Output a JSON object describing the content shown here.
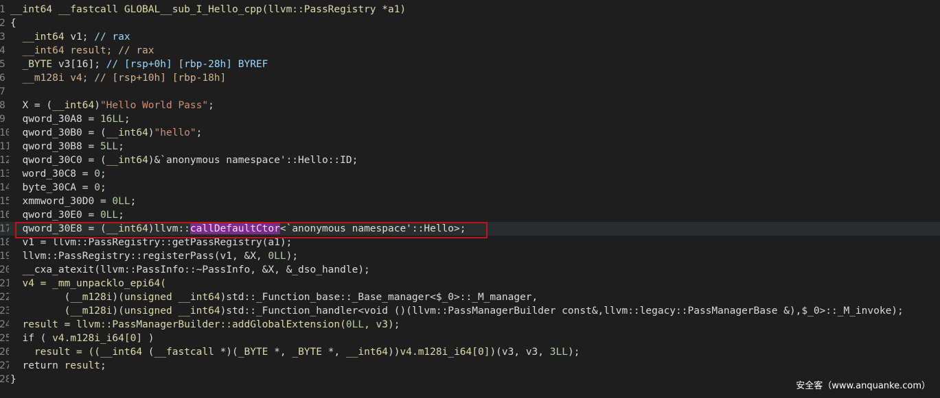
{
  "lines": [
    {
      "n": "1",
      "segments": [
        {
          "t": "__int64 __fastcall GLOBAL__sub_I_Hello_cpp(llvm::PassRegistry *a1)",
          "c": "k"
        }
      ]
    },
    {
      "n": "2",
      "segments": [
        {
          "t": "{",
          "c": ""
        }
      ]
    },
    {
      "n": "3",
      "segments": [
        {
          "t": "  __int64 ",
          "c": "k"
        },
        {
          "t": "v1; ",
          "c": ""
        },
        {
          "t": "// rax",
          "c": "c"
        }
      ]
    },
    {
      "n": "4",
      "segments": [
        {
          "t": "  __int64 result; // rax",
          "c": "kw"
        }
      ]
    },
    {
      "n": "5",
      "segments": [
        {
          "t": "  _BYTE ",
          "c": "k"
        },
        {
          "t": "v3[16]; ",
          "c": ""
        },
        {
          "t": "// [rsp+0h] [rbp-28h] BYREF",
          "c": "c"
        }
      ]
    },
    {
      "n": "6",
      "segments": [
        {
          "t": "  __m128i v4; // [rsp+10h] [rbp-18h]",
          "c": "kw"
        }
      ]
    },
    {
      "n": "7",
      "segments": [
        {
          "t": "",
          "c": ""
        }
      ]
    },
    {
      "n": "8",
      "segments": [
        {
          "t": "  X = (",
          "c": ""
        },
        {
          "t": "__int64",
          "c": "k"
        },
        {
          "t": ")",
          "c": ""
        },
        {
          "t": "\"Hello World Pass\"",
          "c": "s"
        },
        {
          "t": ";",
          "c": ""
        }
      ]
    },
    {
      "n": "9",
      "segments": [
        {
          "t": "  qword_30A8 = ",
          "c": ""
        },
        {
          "t": "16LL",
          "c": "n"
        },
        {
          "t": ";",
          "c": ""
        }
      ]
    },
    {
      "n": "10",
      "segments": [
        {
          "t": "  qword_30B0 = (",
          "c": ""
        },
        {
          "t": "__int64",
          "c": "k"
        },
        {
          "t": ")",
          "c": ""
        },
        {
          "t": "\"hello\"",
          "c": "s"
        },
        {
          "t": ";",
          "c": ""
        }
      ]
    },
    {
      "n": "11",
      "segments": [
        {
          "t": "  qword_30B8 = ",
          "c": ""
        },
        {
          "t": "5LL",
          "c": "n"
        },
        {
          "t": ";",
          "c": ""
        }
      ]
    },
    {
      "n": "12",
      "segments": [
        {
          "t": "  qword_30C0 = (",
          "c": ""
        },
        {
          "t": "__int64",
          "c": "k"
        },
        {
          "t": ")&`anonymous namespace'::Hello::ID;",
          "c": ""
        }
      ]
    },
    {
      "n": "13",
      "segments": [
        {
          "t": "  word_30C8 = ",
          "c": ""
        },
        {
          "t": "0",
          "c": "n"
        },
        {
          "t": ";",
          "c": ""
        }
      ]
    },
    {
      "n": "14",
      "segments": [
        {
          "t": "  byte_30CA = ",
          "c": ""
        },
        {
          "t": "0",
          "c": "n"
        },
        {
          "t": ";",
          "c": ""
        }
      ]
    },
    {
      "n": "15",
      "segments": [
        {
          "t": "  xmmword_30D0 = ",
          "c": ""
        },
        {
          "t": "0LL",
          "c": "n"
        },
        {
          "t": ";",
          "c": ""
        }
      ]
    },
    {
      "n": "16",
      "segments": [
        {
          "t": "  qword_30E0 = ",
          "c": ""
        },
        {
          "t": "0LL",
          "c": "n"
        },
        {
          "t": ";",
          "c": ""
        }
      ]
    },
    {
      "n": "17",
      "segments": [
        {
          "t": "  qword_30E8 = (",
          "c": ""
        },
        {
          "t": "__int64",
          "c": "k"
        },
        {
          "t": ")llvm::",
          "c": ""
        },
        {
          "t": "callDefaultCtor",
          "c": "hl-mark"
        },
        {
          "t": "<`anonymous namespace'::Hello>;",
          "c": ""
        }
      ]
    },
    {
      "n": "18",
      "segments": [
        {
          "t": "  v1 = llvm::PassRegistry::getPassRegistry(a1);",
          "c": ""
        }
      ]
    },
    {
      "n": "19",
      "segments": [
        {
          "t": "  llvm::PassRegistry::registerPass(v1, &X, ",
          "c": ""
        },
        {
          "t": "0LL",
          "c": "n"
        },
        {
          "t": ");",
          "c": ""
        }
      ]
    },
    {
      "n": "20",
      "segments": [
        {
          "t": "  __cxa_atexit(llvm::PassInfo::~PassInfo, &X, &_dso_handle);",
          "c": ""
        }
      ]
    },
    {
      "n": "21",
      "segments": [
        {
          "t": "  v4 = _mm_unpacklo_epi64(",
          "c": "k"
        }
      ]
    },
    {
      "n": "22",
      "segments": [
        {
          "t": "         (",
          "c": ""
        },
        {
          "t": "__m128i",
          "c": "k"
        },
        {
          "t": ")(",
          "c": ""
        },
        {
          "t": "unsigned __int64",
          "c": "k"
        },
        {
          "t": ")std::_Function_base::_Base_manager<$_0>::_M_manager,",
          "c": ""
        }
      ]
    },
    {
      "n": "23",
      "segments": [
        {
          "t": "         (",
          "c": ""
        },
        {
          "t": "__m128i",
          "c": "k"
        },
        {
          "t": ")(",
          "c": ""
        },
        {
          "t": "unsigned __int64",
          "c": "k"
        },
        {
          "t": ")std::_Function_handler<void ()(llvm::PassManagerBuilder const&,llvm::legacy::PassManagerBase &),$_0>::_M_invoke);",
          "c": ""
        }
      ]
    },
    {
      "n": "24",
      "segments": [
        {
          "t": "  result = llvm::PassManagerBuilder::addGlobalExtension(",
          "c": "k"
        },
        {
          "t": "0LL",
          "c": "n"
        },
        {
          "t": ", v3);",
          "c": "k"
        }
      ]
    },
    {
      "n": "25",
      "segments": [
        {
          "t": "  if ( ",
          "c": ""
        },
        {
          "t": "v4.m128i_i64[0]",
          "c": "k"
        },
        {
          "t": " )",
          "c": ""
        }
      ]
    },
    {
      "n": "26",
      "segments": [
        {
          "t": "    result = ((",
          "c": "k"
        },
        {
          "t": "__int64",
          "c": "k"
        },
        {
          "t": " (",
          "c": ""
        },
        {
          "t": "__fastcall",
          "c": "k"
        },
        {
          "t": " *)(",
          "c": ""
        },
        {
          "t": "_BYTE",
          "c": "k"
        },
        {
          "t": " *, ",
          "c": ""
        },
        {
          "t": "_BYTE",
          "c": "k"
        },
        {
          "t": " *, ",
          "c": ""
        },
        {
          "t": "__int64",
          "c": "k"
        },
        {
          "t": "))",
          "c": ""
        },
        {
          "t": "v4.m128i_i64[0]",
          "c": "k"
        },
        {
          "t": ")(v3, v3, ",
          "c": ""
        },
        {
          "t": "3LL",
          "c": "n"
        },
        {
          "t": ");",
          "c": ""
        }
      ]
    },
    {
      "n": "27",
      "segments": [
        {
          "t": "  return ",
          "c": ""
        },
        {
          "t": "result",
          "c": "k"
        },
        {
          "t": ";",
          "c": ""
        }
      ]
    },
    {
      "n": "28",
      "segments": [
        {
          "t": "}",
          "c": ""
        }
      ]
    }
  ],
  "selected_line": "17",
  "watermark": "安全客（www.anquanke.com）"
}
